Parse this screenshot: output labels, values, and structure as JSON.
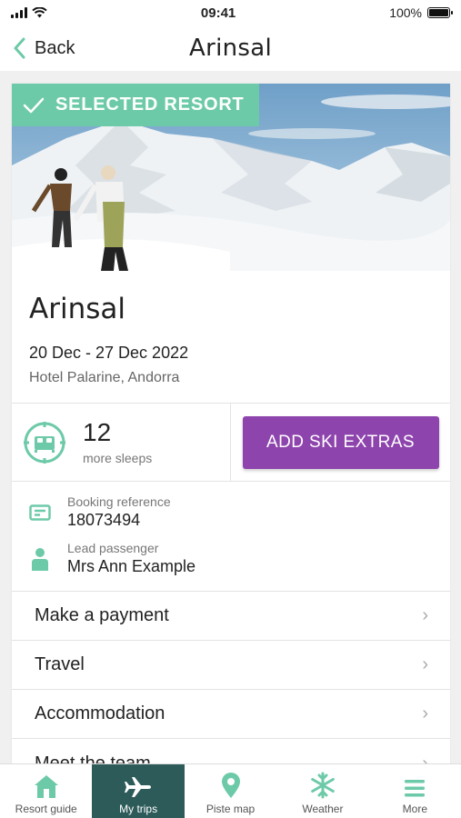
{
  "status": {
    "time": "09:41",
    "battery": "100%"
  },
  "nav": {
    "back_label": "Back",
    "title": "Arinsal"
  },
  "hero": {
    "badge": "SELECTED RESORT"
  },
  "resort": {
    "name": "Arinsal",
    "dates": "20 Dec - 27 Dec 2022",
    "hotel": "Hotel Palarine, Andorra"
  },
  "sleeps": {
    "count": "12",
    "label": "more sleeps",
    "button": "ADD SKI EXTRAS"
  },
  "booking": {
    "ref_label": "Booking reference",
    "ref_value": "18073494",
    "lead_label": "Lead passenger",
    "lead_value": "Mrs Ann Example"
  },
  "menu": [
    {
      "label": "Make a payment"
    },
    {
      "label": "Travel"
    },
    {
      "label": "Accommodation"
    },
    {
      "label": "Meet the team"
    }
  ],
  "tabs": [
    {
      "label": "Resort guide",
      "icon": "house-icon"
    },
    {
      "label": "My trips",
      "icon": "plane-icon"
    },
    {
      "label": "Piste map",
      "icon": "map-pin-icon"
    },
    {
      "label": "Weather",
      "icon": "snowflake-icon"
    },
    {
      "label": "More",
      "icon": "menu-icon"
    }
  ],
  "colors": {
    "accent": "#6dcaa8",
    "button": "#8e44ad",
    "active_tab": "#2c5b5a"
  }
}
